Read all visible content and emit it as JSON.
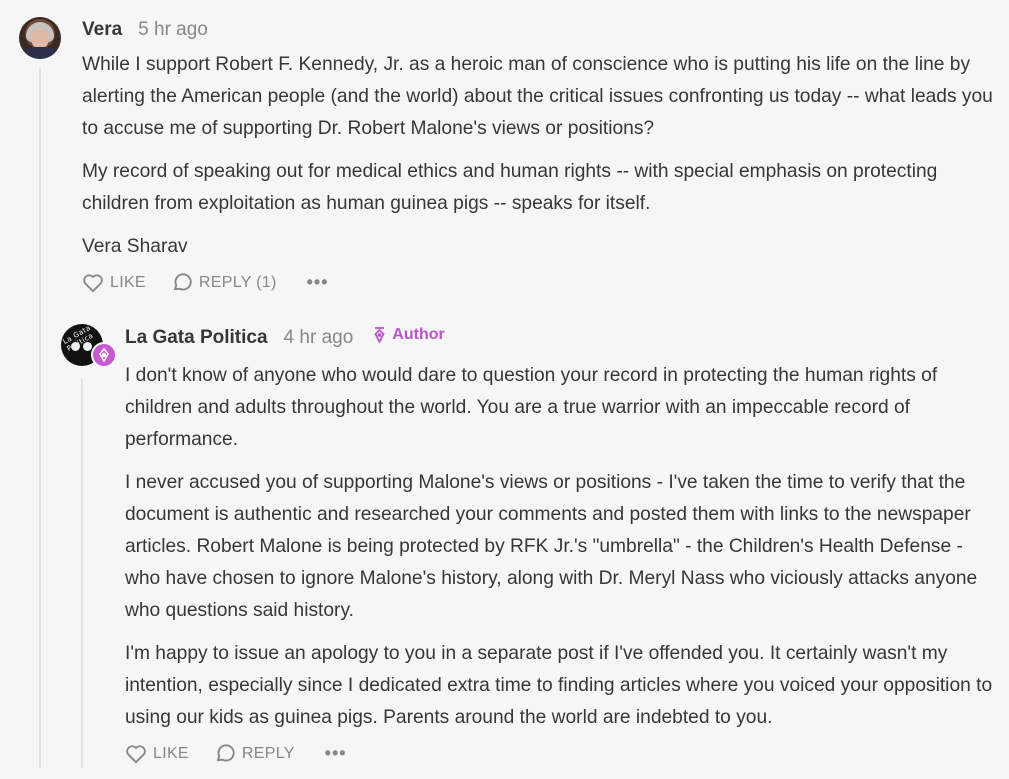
{
  "comments": [
    {
      "author": "Vera",
      "time": "5 hr ago",
      "paragraphs": [
        "While I support Robert F. Kennedy, Jr. as a heroic man of conscience who is putting his life on the line by alerting the American people (and the world) about the critical issues confronting us today -- what leads you to accuse me of supporting Dr. Robert Malone's views or positions?",
        "My record of speaking out for medical ethics and human rights -- with special emphasis on protecting children from exploitation as human guinea pigs -- speaks for itself.",
        "Vera Sharav"
      ],
      "like_label": "LIKE",
      "reply_label": "REPLY (1)",
      "more_label": "•••"
    },
    {
      "author": "La Gata Politica",
      "time": "4 hr ago",
      "author_tag": "Author",
      "avatar_text": "La Gata Politica",
      "paragraphs": [
        "I don't know of anyone who would dare to question your record in protecting the human rights of children and adults throughout the world. You are a true warrior with an impeccable record of performance.",
        "I never accused you of supporting Malone's views or positions - I've taken the time to verify that the document is authentic and researched your comments and posted them with links to the newspaper articles. Robert Malone is being protected by RFK Jr.'s \"umbrella\" - the Children's Health Defense - who have chosen to ignore Malone's history, along with Dr. Meryl Nass who viciously attacks anyone who questions said history.",
        "I'm happy to issue an apology to you in a separate post if I've offended you. It certainly wasn't my intention, especially since I dedicated extra time to finding articles where you voiced your opposition to using our kids as guinea pigs. Parents around the world are indebted to you."
      ],
      "like_label": "LIKE",
      "reply_label": "REPLY",
      "more_label": "•••"
    }
  ],
  "colors": {
    "background": "#f6f6f6",
    "text": "#363737",
    "muted": "#868787",
    "author_accent": "#b856c8",
    "thread_line": "#e3e3e3"
  },
  "icons": [
    "heart-icon",
    "speech-bubble-icon",
    "more-icon",
    "pen-nib-icon"
  ]
}
